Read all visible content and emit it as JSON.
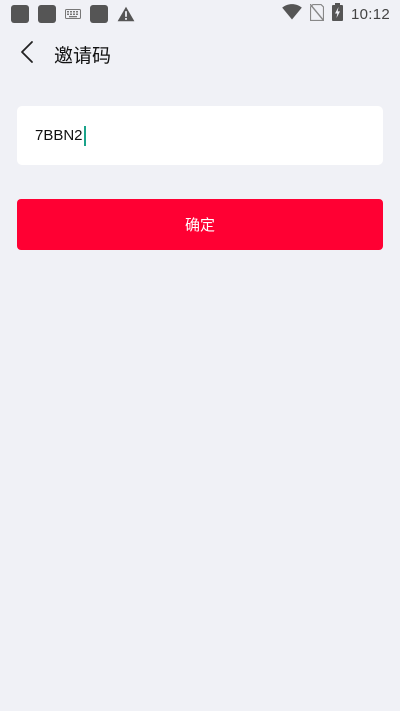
{
  "status_bar": {
    "time": "10:12",
    "icons": [
      "app-notification-icon",
      "app-notification-icon",
      "keyboard-icon",
      "app-notification-icon",
      "warning-icon",
      "wifi-icon",
      "no-sim-icon",
      "battery-charging-icon"
    ]
  },
  "nav": {
    "title": "邀请码",
    "back_icon": "back-arrow-icon"
  },
  "invite": {
    "value": "7BBN2",
    "placeholder": ""
  },
  "confirm": {
    "label": "确定"
  },
  "colors": {
    "background": "#f0f1f6",
    "card": "#ffffff",
    "accent": "#ff0033",
    "caret": "#1aa38a"
  }
}
